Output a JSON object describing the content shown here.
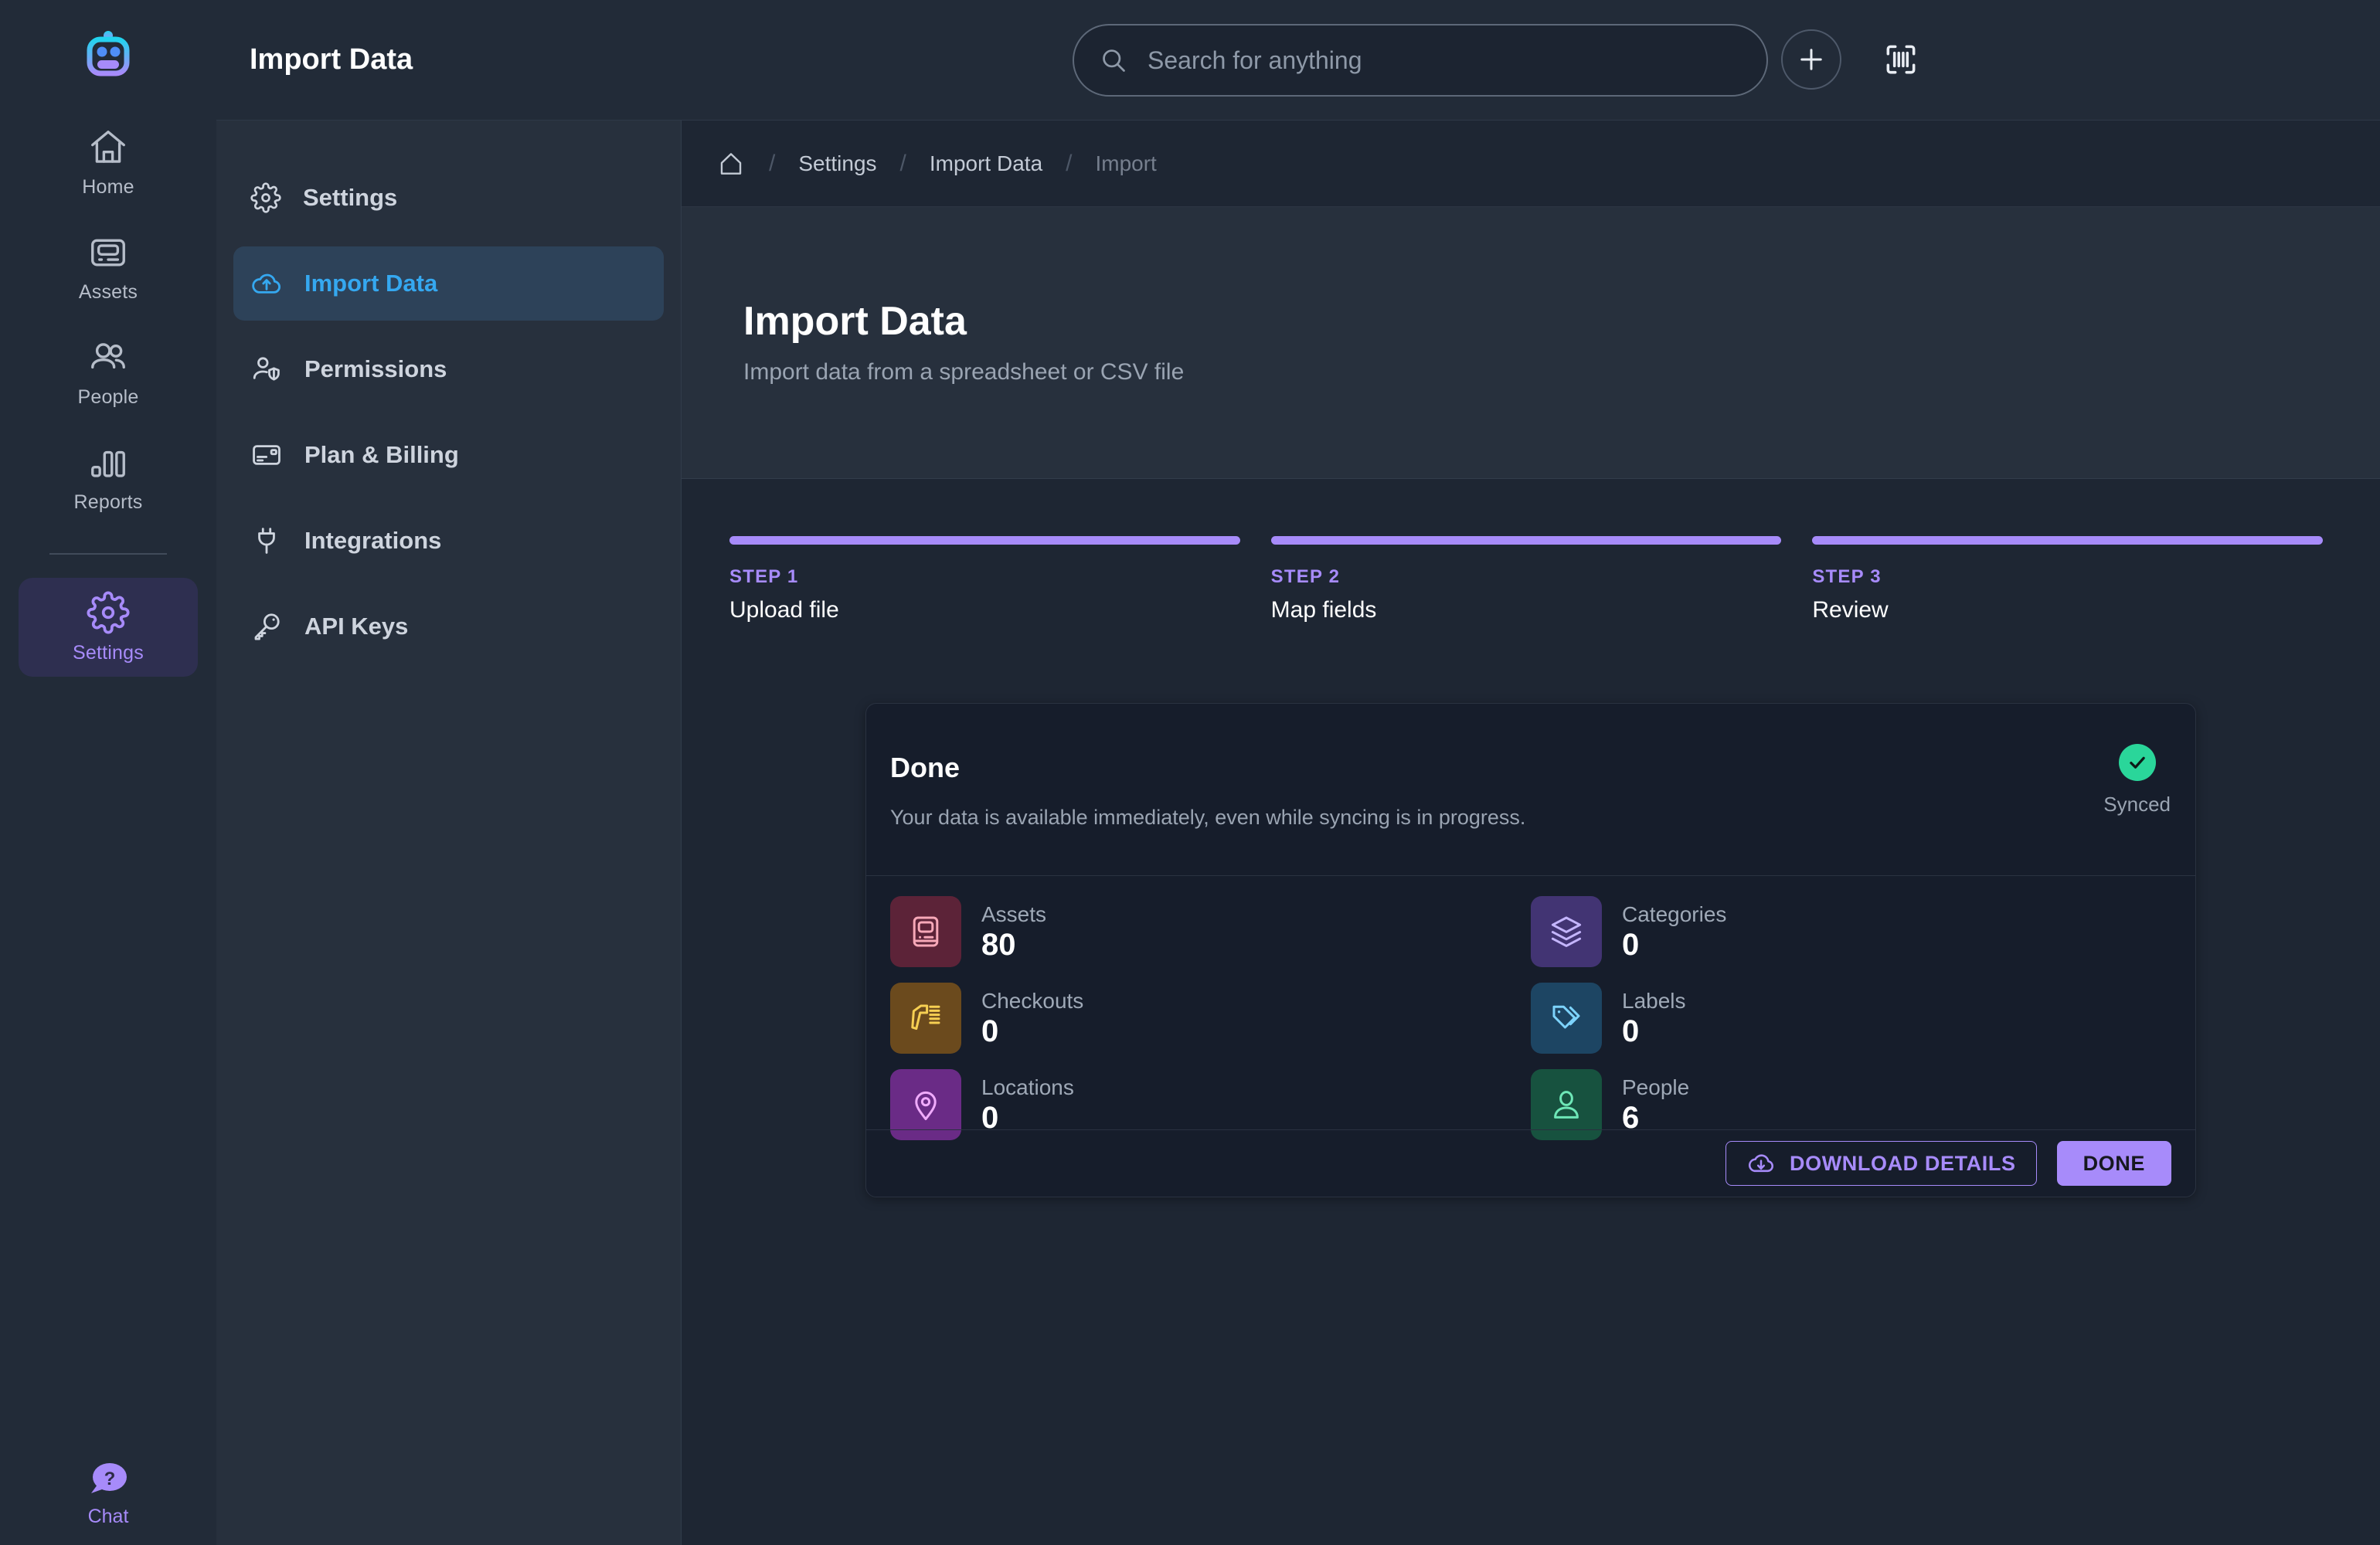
{
  "header": {
    "window_title": "Import Data",
    "search": {
      "placeholder": "Search for anything",
      "icon": "search-icon"
    },
    "add_icon": "plus-icon",
    "scan_icon": "barcode-scan-icon",
    "theme_icon": "moon-icon",
    "avatar_icon": "database-icon",
    "logo_icon": "robot-logo-icon"
  },
  "rail": {
    "items": [
      {
        "label": "Home",
        "icon": "home-icon",
        "active": false
      },
      {
        "label": "Assets",
        "icon": "assets-icon",
        "active": false
      },
      {
        "label": "People",
        "icon": "people-icon",
        "active": false
      },
      {
        "label": "Reports",
        "icon": "reports-icon",
        "active": false
      },
      {
        "label": "Settings",
        "icon": "gear-icon",
        "active": true
      }
    ],
    "chat": {
      "label": "Chat",
      "icon": "chat-help-icon"
    }
  },
  "subnav": {
    "items": [
      {
        "label": "Settings",
        "icon": "gear-icon",
        "active": false
      },
      {
        "label": "Import Data",
        "icon": "cloud-upload-icon",
        "active": true
      },
      {
        "label": "Permissions",
        "icon": "user-shield-icon",
        "active": false
      },
      {
        "label": "Plan & Billing",
        "icon": "credit-card-icon",
        "active": false
      },
      {
        "label": "Integrations",
        "icon": "plug-icon",
        "active": false
      },
      {
        "label": "API Keys",
        "icon": "key-icon",
        "active": false
      }
    ]
  },
  "breadcrumb": {
    "home_icon": "home-outline-icon",
    "separator": "/",
    "items": [
      {
        "label": "Settings",
        "current": false
      },
      {
        "label": "Import Data",
        "current": false
      },
      {
        "label": "Import",
        "current": true
      }
    ]
  },
  "page": {
    "title": "Import Data",
    "subtitle": "Import data from a spreadsheet or CSV file"
  },
  "stepper": {
    "steps": [
      {
        "num": "STEP 1",
        "name": "Upload file"
      },
      {
        "num": "STEP 2",
        "name": "Map fields"
      },
      {
        "num": "STEP 3",
        "name": "Review"
      }
    ]
  },
  "result_card": {
    "title": "Done",
    "description": "Your data is available immediately, even while syncing is in progress.",
    "sync_status": "Synced",
    "sync_icon": "check-circle-icon",
    "stats": [
      {
        "label": "Assets",
        "value": "80",
        "icon": "assets-icon",
        "tile_color": "#5c2338",
        "glyph_color": "#f7a8b8"
      },
      {
        "label": "Categories",
        "value": "0",
        "icon": "layers-icon",
        "tile_color": "#423473",
        "glyph_color": "#c4b5fd"
      },
      {
        "label": "Checkouts",
        "value": "0",
        "icon": "scanner-icon",
        "tile_color": "#6b4a1d",
        "glyph_color": "#f6cf52"
      },
      {
        "label": "Labels",
        "value": "0",
        "icon": "tag-icon",
        "tile_color": "#1d4563",
        "glyph_color": "#7dd3fc"
      },
      {
        "label": "Locations",
        "value": "0",
        "icon": "map-pin-icon",
        "tile_color": "#6a2b86",
        "glyph_color": "#f0abfc"
      },
      {
        "label": "People",
        "value": "6",
        "icon": "person-icon",
        "tile_color": "#17523f",
        "glyph_color": "#6ee7b7"
      }
    ],
    "download_label": "DOWNLOAD DETAILS",
    "download_icon": "cloud-download-icon",
    "done_label": "DONE"
  },
  "colors": {
    "accent_purple": "#a78bfa",
    "accent_blue": "#35a8f0",
    "sync_green": "#2ad69a",
    "rail_bg": "#222b38",
    "subnav_bg": "#27303d",
    "body_bg": "#1e2633",
    "card_bg": "#161d2b"
  }
}
